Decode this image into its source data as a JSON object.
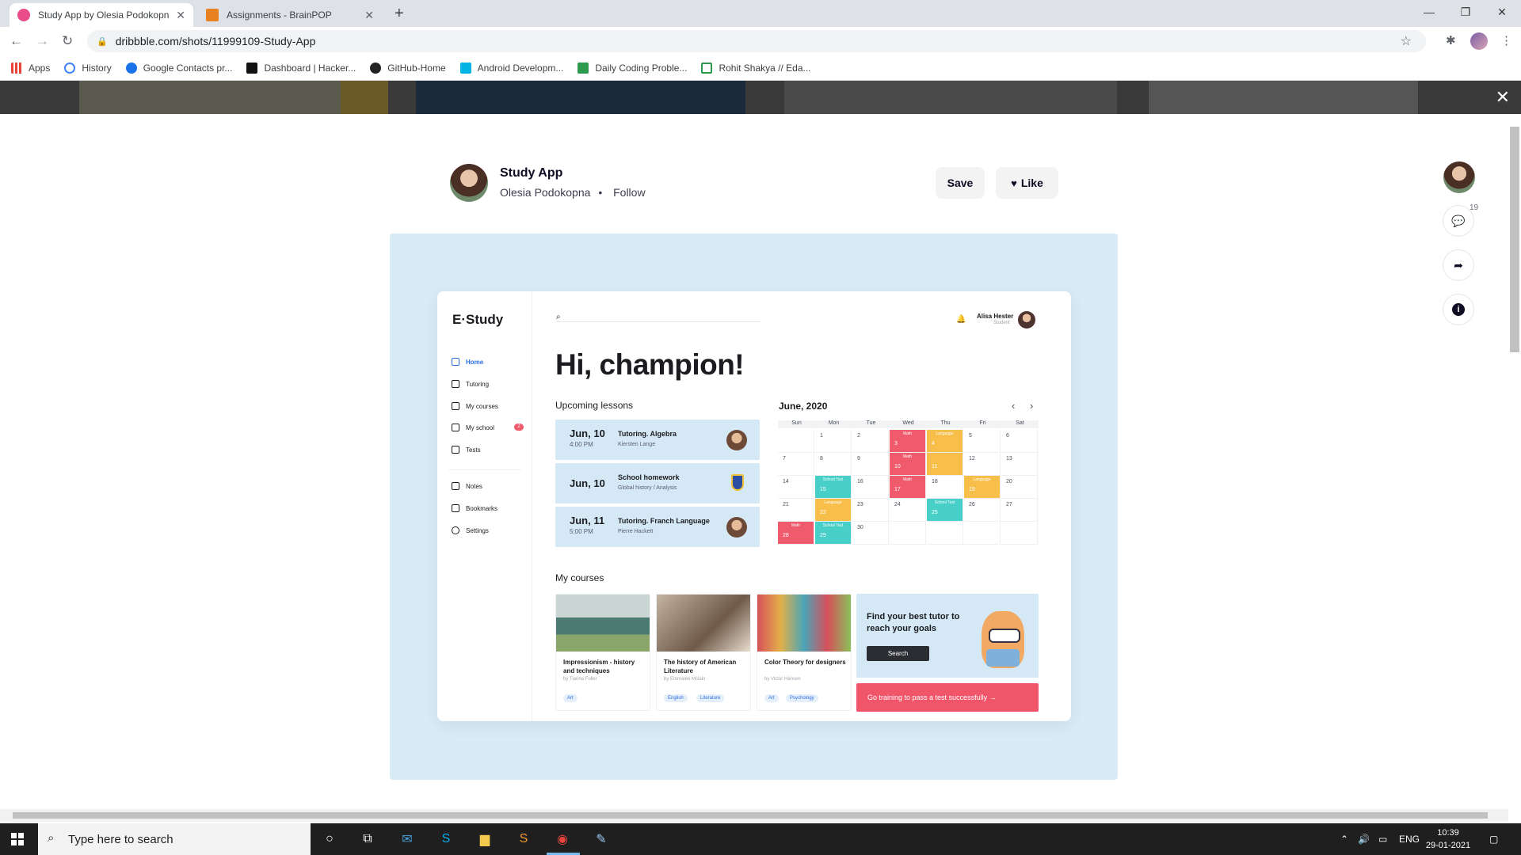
{
  "browser": {
    "tabs": [
      {
        "title": "Study App by Olesia Podokopna",
        "color": "#ea4c89"
      },
      {
        "title": "Assignments - BrainPOP",
        "color": "#e8821e"
      }
    ],
    "url": "dribbble.com/shots/11999109-Study-App",
    "bookmarks": [
      {
        "label": "Apps",
        "icon": "apps-grid-icon"
      },
      {
        "label": "History",
        "icon": "history-icon"
      },
      {
        "label": "Google Contacts pr...",
        "icon": "contacts-icon"
      },
      {
        "label": "Dashboard | Hacker...",
        "icon": "hackerrank-icon"
      },
      {
        "label": "GitHub-Home",
        "icon": "github-icon"
      },
      {
        "label": "Android Developm...",
        "icon": "udacity-icon"
      },
      {
        "label": "Daily Coding Proble...",
        "icon": "dcp-icon"
      },
      {
        "label": "Rohit Shakya // Eda...",
        "icon": "edabit-icon"
      }
    ]
  },
  "shot": {
    "title": "Study App",
    "author": "Olesia Podokopna",
    "separator": "•",
    "follow": "Follow",
    "save": "Save",
    "like": "Like",
    "comment_count": "19"
  },
  "app": {
    "logo": "E·Study",
    "nav": [
      "Home",
      "Tutoring",
      "My courses",
      "My school",
      "Tests",
      "Notes",
      "Bookmarks",
      "Settings"
    ],
    "school_badge": "2",
    "user_name": "Alisa Hester",
    "user_role": "Student",
    "greeting": "Hi, champion!",
    "upcoming_title": "Upcoming lessons",
    "lessons": [
      {
        "date": "Jun, 10",
        "time": "4:00 PM",
        "subject": "Tutoring. Algebra",
        "note": "Kiersten Lange"
      },
      {
        "date": "Jun, 10",
        "time": "",
        "subject": "School homework",
        "note": "Global history / Analysis"
      },
      {
        "date": "Jun, 11",
        "time": "5:00 PM",
        "subject": "Tutoring. Franch Language",
        "note": "Pierre Hackett"
      }
    ],
    "calendar": {
      "month": "June, 2020",
      "weekdays": [
        "Sun",
        "Mon",
        "Tue",
        "Wed",
        "Thu",
        "Fri",
        "Sat"
      ],
      "weeks": [
        [
          "",
          "1",
          "2",
          "3",
          "4",
          "5",
          "6"
        ],
        [
          "7",
          "8",
          "9",
          "10",
          "11",
          "12",
          "13"
        ],
        [
          "14",
          "15",
          "16",
          "17",
          "18",
          "19",
          "20"
        ],
        [
          "21",
          "22",
          "23",
          "24",
          "25",
          "26",
          "27"
        ],
        [
          "28",
          "29",
          "30",
          "",
          "",
          "",
          ""
        ]
      ],
      "events": [
        {
          "day": "3",
          "label": "Math",
          "color": "#f05a6d"
        },
        {
          "day": "4",
          "label": "Language",
          "color": "#f7be4a"
        },
        {
          "day": "10",
          "label": "Math",
          "color": "#f05a6d"
        },
        {
          "day": "11",
          "label": "",
          "color": "#f7be4a"
        },
        {
          "day": "15",
          "label": "School Test",
          "color": "#48cfc8"
        },
        {
          "day": "17",
          "label": "Math",
          "color": "#f05a6d"
        },
        {
          "day": "19",
          "label": "Language",
          "color": "#f7be4a"
        },
        {
          "day": "22",
          "label": "Language",
          "color": "#f7be4a"
        },
        {
          "day": "25",
          "label": "School Test",
          "color": "#48cfc8"
        },
        {
          "day": "28",
          "label": "Math",
          "color": "#f05a6d"
        },
        {
          "day": "29",
          "label": "School Test",
          "color": "#48cfc8"
        }
      ]
    },
    "courses_title": "My courses",
    "courses": [
      {
        "title": "Impressionism - history and techniques",
        "by": "by  Tianna Fuller",
        "tags": [
          "Art"
        ]
      },
      {
        "title": "The history of American Literature",
        "by": "by  Emmalee Mclain",
        "tags": [
          "English",
          "Literature"
        ]
      },
      {
        "title": "Color Theory for designers",
        "by": "by  Victor Hansen",
        "tags": [
          "Art",
          "Psychology"
        ]
      }
    ],
    "promo_text": "Find your best tutor to reach your goals",
    "promo_button": "Search",
    "cta": "Go training to pass a test successfully  →"
  },
  "taskbar": {
    "search_placeholder": "Type here to search",
    "lang": "ENG",
    "time": "10:39",
    "date": "29-01-2021"
  }
}
